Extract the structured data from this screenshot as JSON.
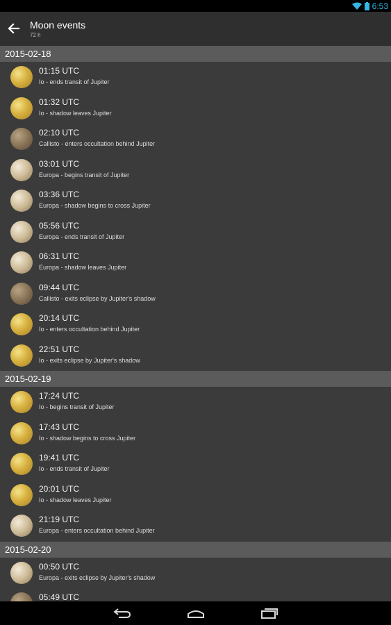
{
  "status_bar": {
    "time": "6:53",
    "wifi_icon": "wifi-icon",
    "battery_icon": "battery-icon"
  },
  "action_bar": {
    "title": "Moon events",
    "subtitle": "72 h",
    "back_icon": "back-arrow-icon"
  },
  "sections": [
    {
      "date": "2015-02-18",
      "events": [
        {
          "moon": "io",
          "time": "01:15 UTC",
          "desc": "Io - ends transit of Jupiter"
        },
        {
          "moon": "io",
          "time": "01:32 UTC",
          "desc": "Io - shadow leaves Jupiter"
        },
        {
          "moon": "callisto",
          "time": "02:10 UTC",
          "desc": "Callisto - enters occultation behind Jupiter"
        },
        {
          "moon": "europa",
          "time": "03:01 UTC",
          "desc": "Europa - begins transit of Jupiter"
        },
        {
          "moon": "europa",
          "time": "03:36 UTC",
          "desc": "Europa - shadow begins to cross Jupiter"
        },
        {
          "moon": "europa",
          "time": "05:56 UTC",
          "desc": "Europa - ends transit of Jupiter"
        },
        {
          "moon": "europa",
          "time": "06:31 UTC",
          "desc": "Europa - shadow leaves Jupiter"
        },
        {
          "moon": "callisto",
          "time": "09:44 UTC",
          "desc": "Callisto - exits eclipse by Jupiter's shadow"
        },
        {
          "moon": "io",
          "time": "20:14 UTC",
          "desc": "Io - enters occultation behind Jupiter"
        },
        {
          "moon": "io",
          "time": "22:51 UTC",
          "desc": "Io - exits eclipse by Jupiter's shadow"
        }
      ]
    },
    {
      "date": "2015-02-19",
      "events": [
        {
          "moon": "io",
          "time": "17:24 UTC",
          "desc": "Io - begins transit of Jupiter"
        },
        {
          "moon": "io",
          "time": "17:43 UTC",
          "desc": "Io - shadow begins to cross Jupiter"
        },
        {
          "moon": "io",
          "time": "19:41 UTC",
          "desc": "Io - ends transit of Jupiter"
        },
        {
          "moon": "io",
          "time": "20:01 UTC",
          "desc": "Io - shadow leaves Jupiter"
        },
        {
          "moon": "europa",
          "time": "21:19 UTC",
          "desc": "Europa - enters occultation behind Jupiter"
        }
      ]
    },
    {
      "date": "2015-02-20",
      "events": [
        {
          "moon": "europa",
          "time": "00:50 UTC",
          "desc": "Europa - exits eclipse by Jupiter's shadow"
        },
        {
          "moon": "callisto",
          "time": "05:49 UTC",
          "desc": ""
        }
      ]
    }
  ],
  "nav_bar": {
    "back_icon": "nav-back-icon",
    "home_icon": "nav-home-icon",
    "recents_icon": "nav-recents-icon"
  },
  "colors": {
    "accent": "#35b5e5",
    "background": "#3b3b3b",
    "section_header": "#5b5b5b",
    "action_bar": "#2f2f2f"
  }
}
